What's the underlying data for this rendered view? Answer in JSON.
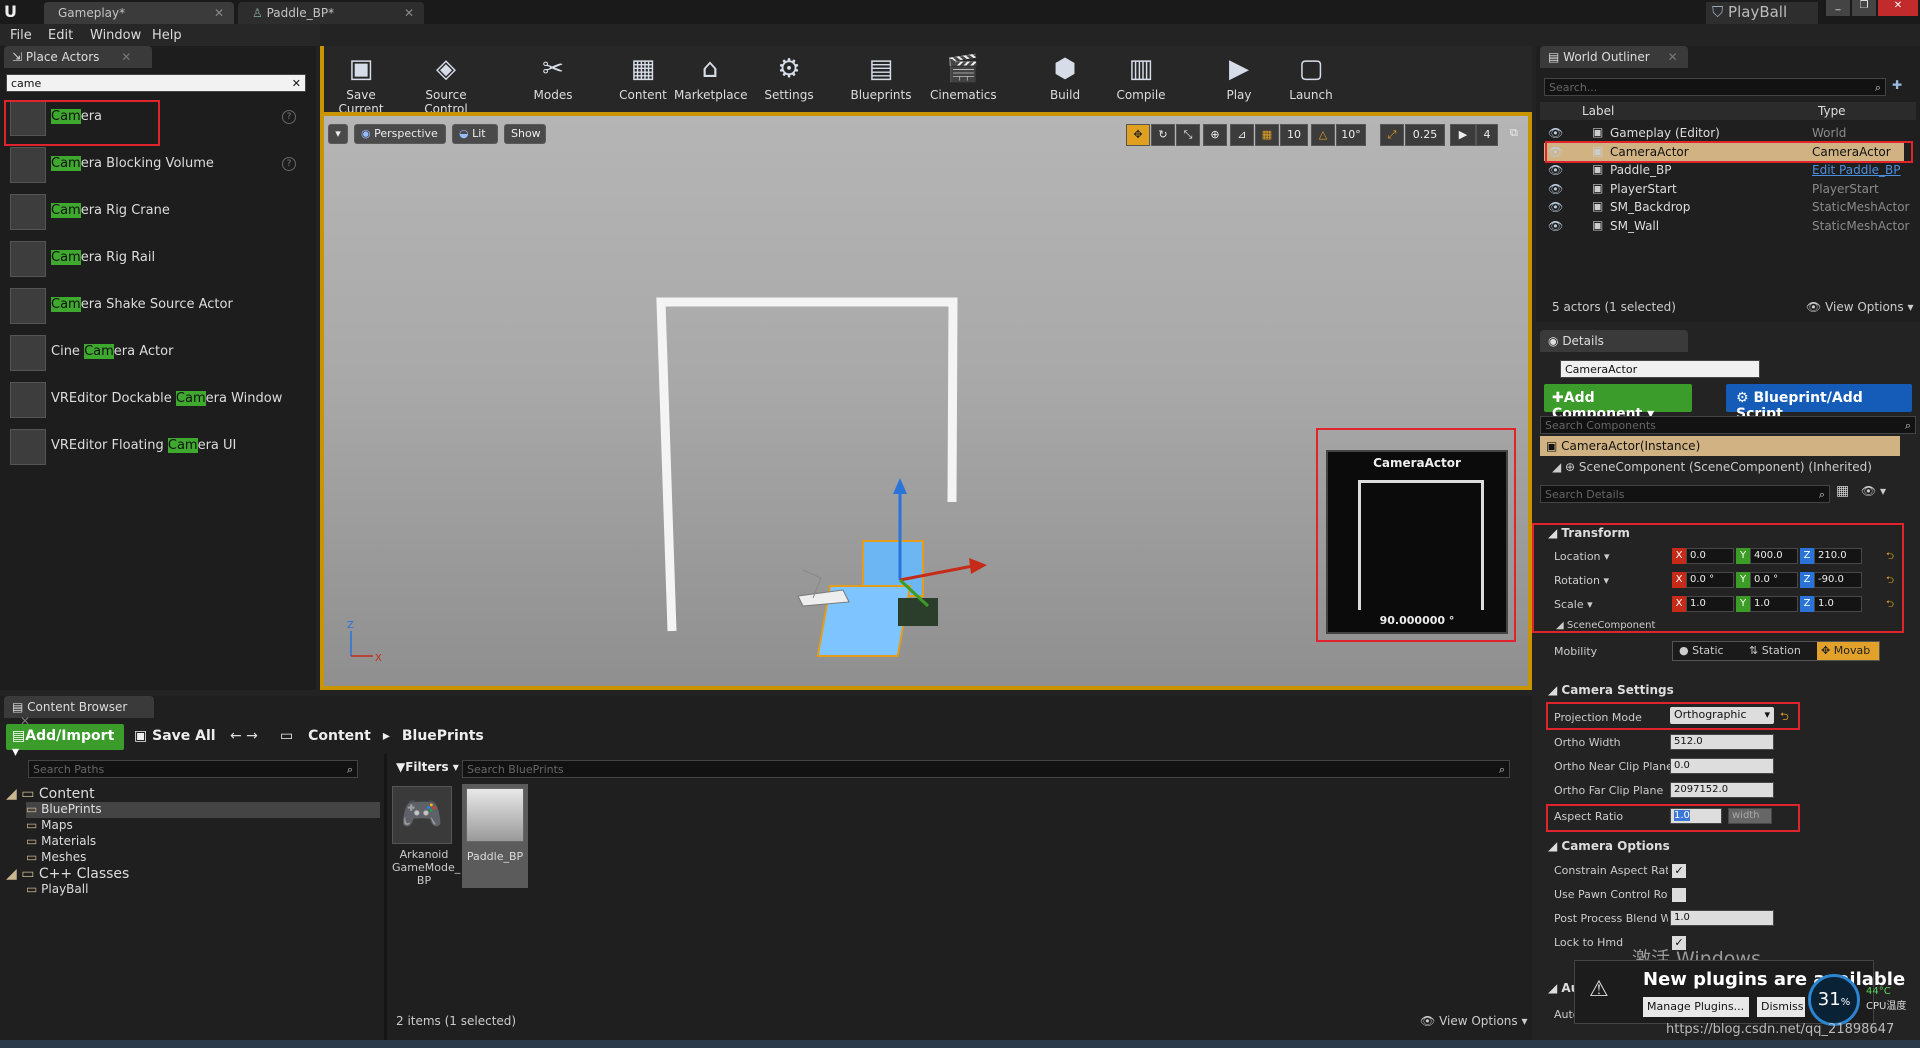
{
  "tabs": {
    "gameplay": "Gameplay*",
    "paddle": "Paddle_BP*",
    "playball": "PlayBall"
  },
  "menu": [
    "File",
    "Edit",
    "Window",
    "Help"
  ],
  "place_actors": {
    "title": "Place Actors",
    "search": "came",
    "items": [
      {
        "pre": "",
        "hl": "Cam",
        "post": "era",
        "full": "Camera"
      },
      {
        "pre": "",
        "hl": "Cam",
        "post": "era Blocking Volume"
      },
      {
        "pre": "",
        "hl": "Cam",
        "post": "era Rig Crane"
      },
      {
        "pre": "",
        "hl": "Cam",
        "post": "era Rig Rail"
      },
      {
        "pre": "",
        "hl": "Cam",
        "post": "era Shake Source Actor"
      },
      {
        "pre": "Cine ",
        "hl": "Cam",
        "post": "era Actor"
      },
      {
        "pre": "VREditor Dockable ",
        "hl": "Cam",
        "post": "era Window"
      },
      {
        "pre": "VREditor Floating ",
        "hl": "Cam",
        "post": "era UI"
      }
    ]
  },
  "toolbar": [
    "Save Current",
    "Source Control",
    "Modes",
    "Content",
    "Marketplace",
    "Settings",
    "Blueprints",
    "Cinematics",
    "Build",
    "Compile",
    "Play",
    "Launch"
  ],
  "viewport": {
    "perspective": "Perspective",
    "lit": "Lit",
    "show": "Show",
    "snap_grid": "10",
    "snap_rot": "10°",
    "snap_scale": "0.25",
    "cam_speed": "4",
    "preview_title": "CameraActor",
    "preview_value": "90.000000 °"
  },
  "outliner": {
    "title": "World Outliner",
    "search": "Search...",
    "col_label": "Label",
    "col_type": "Type",
    "rows": [
      {
        "name": "Gameplay (Editor)",
        "type": "World"
      },
      {
        "name": "CameraActor",
        "type": "CameraActor"
      },
      {
        "name": "Paddle_BP",
        "type": "Edit Paddle_BP"
      },
      {
        "name": "PlayerStart",
        "type": "PlayerStart"
      },
      {
        "name": "SM_Backdrop",
        "type": "StaticMeshActor"
      },
      {
        "name": "SM_Wall",
        "type": "StaticMeshActor"
      }
    ],
    "status": "5 actors (1 selected)",
    "view_options": "View Options"
  },
  "details": {
    "title": "Details",
    "name": "CameraActor",
    "add_component": "Add Component",
    "blueprint": "Blueprint/Add Script",
    "search_components": "Search Components",
    "instance": "CameraActor(Instance)",
    "scene": "SceneComponent (SceneComponent) (Inherited)",
    "search_details": "Search Details",
    "transform": "Transform",
    "location": {
      "label": "Location",
      "x": "0.0",
      "y": "400.0",
      "z": "210.0"
    },
    "rotation": {
      "label": "Rotation",
      "x": "0.0 °",
      "y": "0.0 °",
      "z": "-90.0"
    },
    "scale": {
      "label": "Scale",
      "x": "1.0",
      "y": "1.0",
      "z": "1.0"
    },
    "scene_component": "SceneComponent",
    "mobility": "Mobility",
    "mob_static": "Static",
    "mob_station": "Station",
    "mob_movab": "Movab",
    "camera_settings": "Camera Settings",
    "projection": {
      "label": "Projection Mode",
      "value": "Orthographic"
    },
    "ortho_width": {
      "label": "Ortho Width",
      "value": "512.0"
    },
    "ortho_near": {
      "label": "Ortho Near Clip Plane",
      "value": "0.0"
    },
    "ortho_far": {
      "label": "Ortho Far Clip Plane",
      "value": "2097152.0"
    },
    "aspect": {
      "label": "Aspect Ratio",
      "value": "1.0",
      "width": "width"
    },
    "camera_options": "Camera Options",
    "constrain": "Constrain Aspect Ratio",
    "use_pawn": "Use Pawn Control Rota",
    "post_process": {
      "label": "Post Process Blend W",
      "value": "1.0"
    },
    "lock_hmd": "Lock to Hmd",
    "auto": "Auto",
    "auto2": "Auto"
  },
  "content_browser": {
    "title": "Content Browser",
    "add_import": "Add/Import",
    "save_all": "Save All",
    "path_content": "Content",
    "path_blueprints": "BluePrints",
    "search_paths": "Search Paths",
    "filters": "Filters",
    "search_bp": "Search BluePrints",
    "tree": [
      {
        "label": "Content",
        "level": 0
      },
      {
        "label": "BluePrints",
        "level": 1
      },
      {
        "label": "Maps",
        "level": 1
      },
      {
        "label": "Materials",
        "level": 1
      },
      {
        "label": "Meshes",
        "level": 1
      },
      {
        "label": "C++ Classes",
        "level": 0
      },
      {
        "label": "PlayBall",
        "level": 1
      }
    ],
    "assets": [
      "Arkanoid GameMode_ BP",
      "Paddle_BP"
    ],
    "status": "2 items (1 selected)",
    "view_options": "View Options"
  },
  "notify": {
    "text": "New plugins are available",
    "manage": "Manage Plugins...",
    "dismiss": "Dismiss"
  },
  "overlay": {
    "windows": "激活 Windows",
    "url": "https://blog.csdn.net/qq_21898647",
    "cpu": "31",
    "cpu_unit": "%",
    "temp": "44°C",
    "cpu_label": "CPU温度"
  }
}
